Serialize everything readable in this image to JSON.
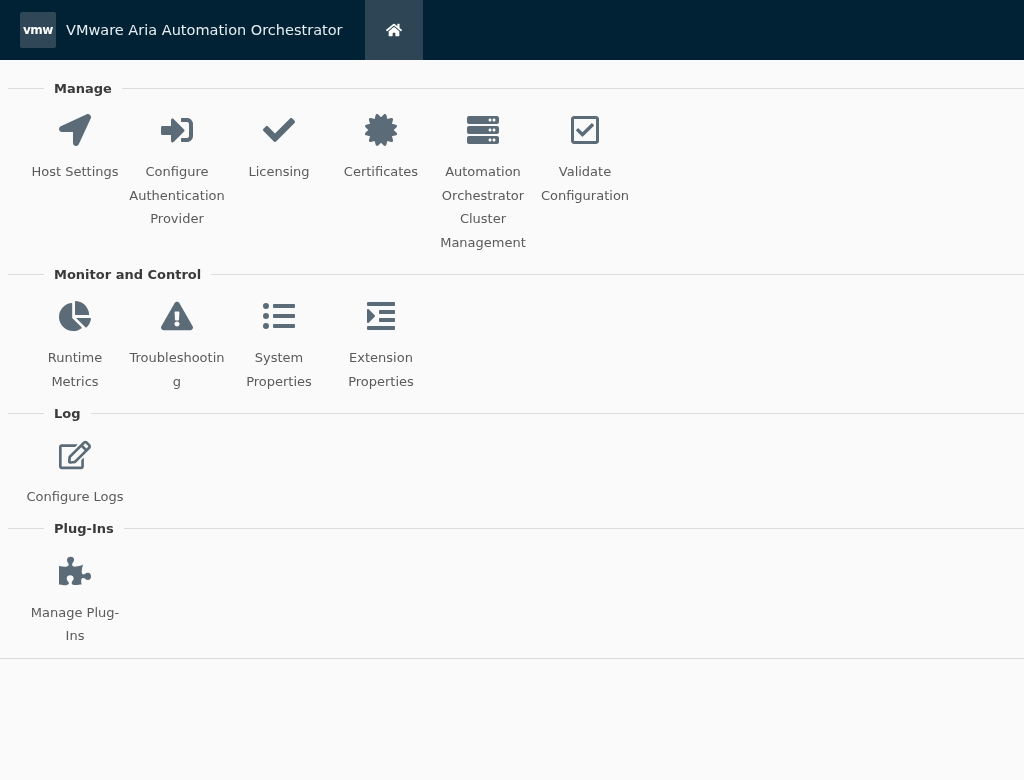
{
  "header": {
    "logo": "vmw",
    "title": "VMware Aria Automation Orchestrator",
    "home_selected": true
  },
  "sections": [
    {
      "title": "Manage",
      "items": [
        {
          "label": "Host Settings"
        },
        {
          "label": "Configure Authentication Provider"
        },
        {
          "label": "Licensing"
        },
        {
          "label": "Certificates"
        },
        {
          "label": "Automation Orchestrator Cluster Management"
        },
        {
          "label": "Validate Configuration"
        }
      ]
    },
    {
      "title": "Monitor and Control",
      "items": [
        {
          "label": "Runtime Metrics"
        },
        {
          "label": "Troubleshooting"
        },
        {
          "label": "System Properties"
        },
        {
          "label": "Extension Properties"
        }
      ]
    },
    {
      "title": "Log",
      "items": [
        {
          "label": "Configure Logs"
        }
      ]
    },
    {
      "title": "Plug-Ins",
      "items": [
        {
          "label": "Manage Plug-Ins"
        }
      ]
    }
  ]
}
